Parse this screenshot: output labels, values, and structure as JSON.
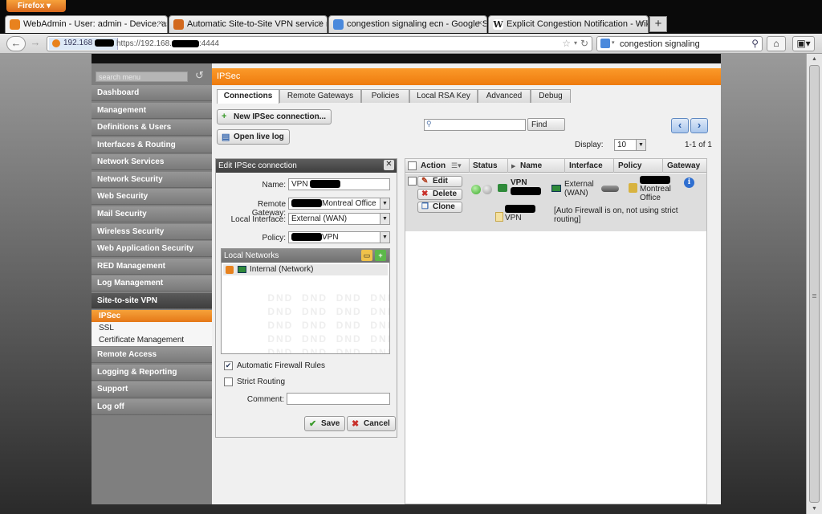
{
  "browser": {
    "menu_label": "Firefox",
    "tabs": [
      {
        "title": "WebAdmin - User: admin - Device: as...",
        "favicon_color": "#e8821e"
      },
      {
        "title": "Automatic Site-to-Site VPN service re...",
        "favicon_color": "#d2691e"
      },
      {
        "title": "congestion signaling ecn - Google Se...",
        "favicon_color": "#4a89dc"
      },
      {
        "title": "Explicit Congestion Notification - Wik...",
        "favicon_color": "#444444"
      }
    ],
    "tab_close": "×",
    "new_tab": "+",
    "site_identity": "192.168",
    "url_prefix": "https://192.168.",
    "url_suffix": ":4444",
    "search_text": "congestion signaling"
  },
  "sidebar": {
    "search_placeholder": "search menu",
    "items": [
      "Dashboard",
      "Management",
      "Definitions & Users",
      "Interfaces & Routing",
      "Network Services",
      "Network Security",
      "Web Security",
      "Mail Security",
      "Wireless Security",
      "Web Application Security",
      "RED Management",
      "Log Management",
      "Site-to-site VPN"
    ],
    "subitems": [
      "IPSec",
      "SSL",
      "Certificate Management"
    ],
    "items_after": [
      "Remote Access",
      "Logging & Reporting",
      "Support",
      "Log off"
    ]
  },
  "main": {
    "title": "IPSec",
    "tabs": [
      "Connections",
      "Remote Gateways",
      "Policies",
      "Local RSA Key",
      "Advanced",
      "Debug"
    ],
    "new_button": "New IPSec connection...",
    "live_log_button": "Open live log",
    "find_button": "Find",
    "display_label": "Display:",
    "display_value": "10",
    "count_label": "1-1 of 1"
  },
  "edit": {
    "title": "Edit IPSec connection",
    "name_label": "Name:",
    "name_value": "VPN",
    "gateway_label": "Remote Gateway:",
    "gateway_value": "Montreal Office",
    "interface_label": "Local Interface:",
    "interface_value": "External (WAN)",
    "policy_label": "Policy:",
    "policy_value": "VPN",
    "local_networks_title": "Local Networks",
    "local_network_item": "Internal (Network)",
    "dnd_watermark": "DND",
    "auto_fw_label": "Automatic Firewall Rules",
    "auto_fw_checked": true,
    "strict_routing_label": "Strict Routing",
    "strict_routing_checked": false,
    "comment_label": "Comment:",
    "save_label": "Save",
    "cancel_label": "Cancel"
  },
  "grid": {
    "columns": [
      "Action",
      "Status",
      "Name",
      "Interface",
      "Policy",
      "Gateway"
    ],
    "row": {
      "edit_label": "Edit",
      "delete_label": "Delete",
      "clone_label": "Clone",
      "name": "VPN",
      "interface": "External (WAN)",
      "gateway": "Montreal Office",
      "policy_sub": "VPN",
      "note": "[Auto Firewall is on, not using strict routing]"
    }
  }
}
